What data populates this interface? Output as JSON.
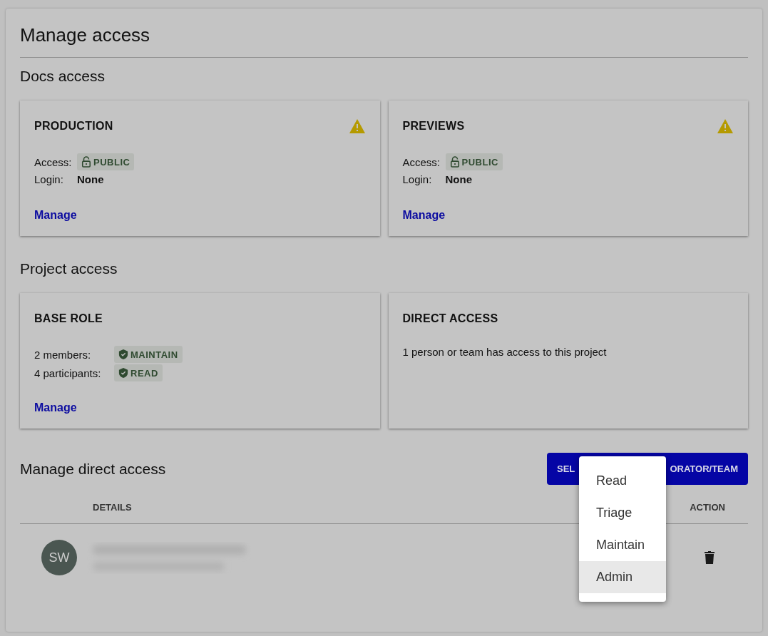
{
  "title": "Manage access",
  "docs_access": {
    "heading": "Docs access",
    "cards": [
      {
        "title": "PRODUCTION",
        "warning": true,
        "rows": [
          {
            "label": "Access:",
            "kind": "access",
            "value": "PUBLIC"
          },
          {
            "label": "Login:",
            "kind": "text",
            "value": "None"
          }
        ],
        "link": "Manage"
      },
      {
        "title": "PREVIEWS",
        "warning": true,
        "rows": [
          {
            "label": "Access:",
            "kind": "access",
            "value": "PUBLIC"
          },
          {
            "label": "Login:",
            "kind": "text",
            "value": "None"
          }
        ],
        "link": "Manage"
      }
    ]
  },
  "project_access": {
    "heading": "Project access",
    "cards": [
      {
        "title": "BASE ROLE",
        "warning": false,
        "rows": [
          {
            "label": "2 members:",
            "kind": "role",
            "value": "MAINTAIN"
          },
          {
            "label": "4 participants:",
            "kind": "role",
            "value": "READ"
          }
        ],
        "link": "Manage"
      },
      {
        "title": "DIRECT ACCESS",
        "warning": false,
        "text": "1 person or team has access to this project"
      }
    ]
  },
  "direct_access": {
    "heading": "Manage direct access",
    "button": {
      "label_start": "SEL",
      "label_end": "ORATOR/TEAM"
    },
    "columns": [
      "DETAILS",
      "ACTION"
    ],
    "rows": [
      {
        "initials": "SW"
      }
    ]
  },
  "role_menu": [
    {
      "label": "Read",
      "selected": false
    },
    {
      "label": "Triage",
      "selected": false
    },
    {
      "label": "Maintain",
      "selected": false
    },
    {
      "label": "Admin",
      "selected": true
    }
  ]
}
